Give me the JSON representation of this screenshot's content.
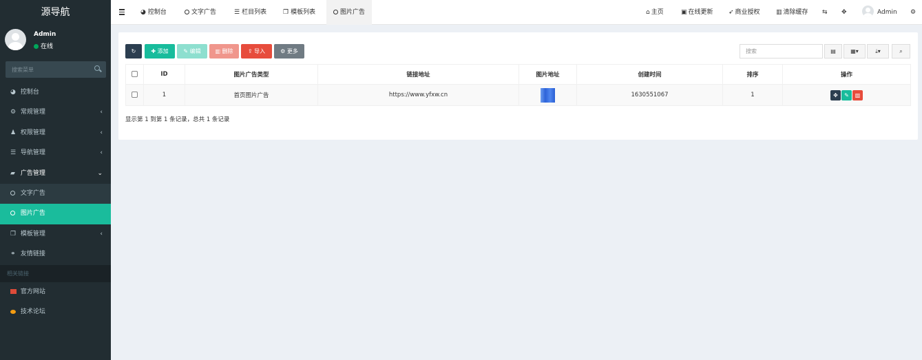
{
  "sidebar": {
    "logo": "源导航",
    "user": {
      "name": "Admin",
      "status": "在线"
    },
    "search_placeholder": "搜索菜单",
    "items": [
      {
        "label": "控制台",
        "icon": "dashboard-icon",
        "glyph": "◕"
      },
      {
        "label": "常规管理",
        "icon": "cogs-icon",
        "glyph": "⚙",
        "arrow": "‹"
      },
      {
        "label": "权限管理",
        "icon": "group-icon",
        "glyph": "👥",
        "arrow": "‹"
      },
      {
        "label": "导航管理",
        "icon": "list-icon",
        "glyph": "☰",
        "arrow": "‹"
      },
      {
        "label": "广告管理",
        "icon": "car-icon",
        "glyph": "🚗",
        "arrow": "⌄"
      },
      {
        "label": "文字广告",
        "icon": "circle-icon"
      },
      {
        "label": "图片广告",
        "icon": "circle-icon"
      },
      {
        "label": "模板管理",
        "icon": "clone-icon",
        "glyph": "❐",
        "arrow": "‹"
      },
      {
        "label": "友情链接",
        "icon": "link-icon",
        "glyph": "🔗"
      }
    ],
    "section_header": "相关链接",
    "links": [
      {
        "label": "官方网站",
        "icon": "list-red-icon"
      },
      {
        "label": "技术论坛",
        "icon": "comment-icon"
      }
    ]
  },
  "topbar": {
    "tabs": [
      {
        "label": "控制台",
        "icon": "dashboard-icon",
        "glyph": "◕"
      },
      {
        "label": "文字广告",
        "icon": "circle-icon"
      },
      {
        "label": "栏目列表",
        "icon": "list-icon",
        "glyph": "☰"
      },
      {
        "label": "模板列表",
        "icon": "clone-icon",
        "glyph": "❐"
      },
      {
        "label": "图片广告",
        "icon": "circle-icon"
      }
    ],
    "right": [
      {
        "label": "主页",
        "icon": "home-icon",
        "glyph": "⌂"
      },
      {
        "label": "在线更新",
        "icon": "vimeo-icon",
        "glyph": "▣"
      },
      {
        "label": "商业授权",
        "icon": "rocket-icon",
        "glyph": "➶"
      },
      {
        "label": "清除缓存",
        "icon": "trash-icon",
        "glyph": "🗑"
      }
    ],
    "admin": "Admin"
  },
  "toolbar": {
    "add": "添加",
    "edit": "编辑",
    "delete": "删除",
    "import": "导入",
    "more": "更多",
    "search_placeholder": "搜索"
  },
  "table": {
    "headers": [
      "ID",
      "图片广告类型",
      "链接地址",
      "图片地址",
      "创建时间",
      "排序",
      "操作"
    ],
    "rows": [
      {
        "id": "1",
        "type": "首页图片广告",
        "url": "https://www.yfxw.cn",
        "created": "1630551067",
        "sort": "1"
      }
    ],
    "info": "显示第 1 到第 1 条记录，总共 1 条记录"
  },
  "colors": {
    "sidebar_bg": "#222d32",
    "active": "#1abc9c",
    "primary_dark": "#2c3e50",
    "danger": "#e74c3c"
  }
}
